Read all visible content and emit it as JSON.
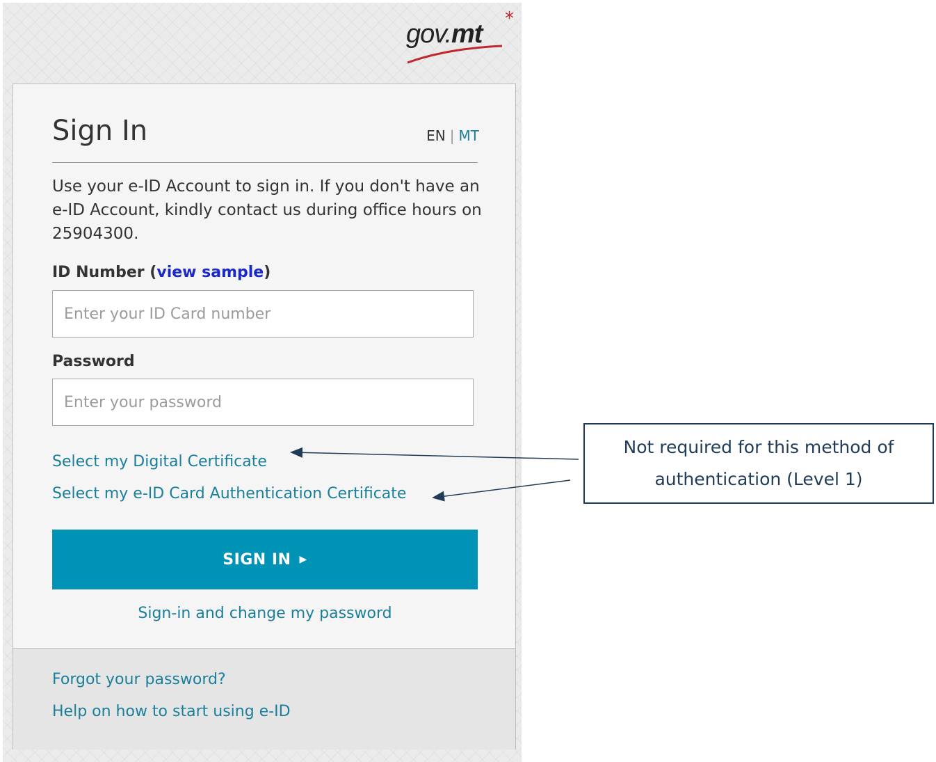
{
  "brand": {
    "logo_text": "gov.mt",
    "logo_prefix": "gov.",
    "logo_suffix": "mt",
    "star": "*",
    "star_color": "#c0282d"
  },
  "card": {
    "title": "Sign In",
    "lang_en": "EN",
    "lang_sep": "|",
    "lang_mt": "MT",
    "intro": "Use your e-ID Account to sign in. If you don't have an e-ID Account, kindly contact us during office hours on 25904300."
  },
  "form": {
    "id_label": "ID Number",
    "id_label_open": "(",
    "id_sample_link": "view sample",
    "id_label_close": ")",
    "id_placeholder": "Enter your ID Card number",
    "id_value": "",
    "password_label": "Password",
    "password_placeholder": "Enter your password",
    "password_value": ""
  },
  "links": {
    "digital_cert": "Select my Digital Certificate",
    "eid_cert": "Select my e-ID Card Authentication Certificate",
    "change_password": "Sign-in and change my password",
    "forgot_password": "Forgot your password?",
    "help": "Help on how to start using e-ID"
  },
  "button": {
    "signin_label": "SIGN IN",
    "arrow": "▶"
  },
  "annotation": {
    "text": "Not required for this method of authentication (Level 1)"
  },
  "colors": {
    "accent": "#0093b5",
    "link": "#1a7f9b",
    "sample_link": "#1a29c8",
    "callout_border": "#1f3b57"
  }
}
